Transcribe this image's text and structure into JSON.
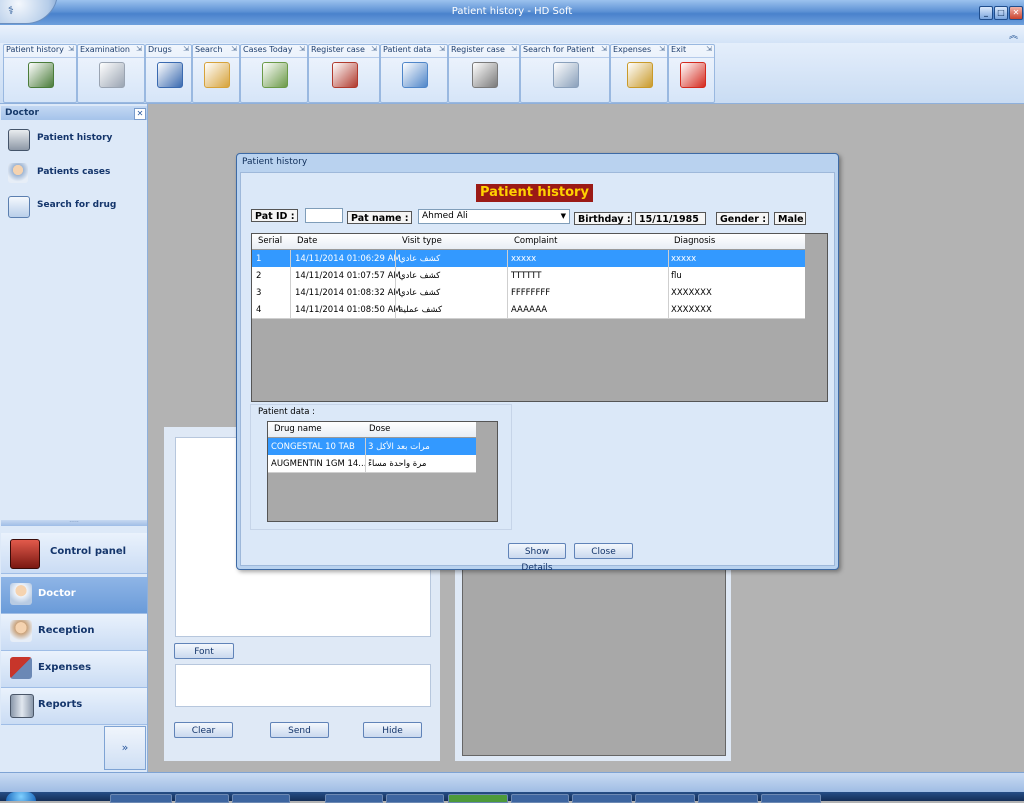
{
  "window": {
    "title": "Patient history - HD Soft"
  },
  "window_controls": [
    "_",
    "□",
    "✕"
  ],
  "ribbon": {
    "groups": [
      {
        "label": "Patient history",
        "icon": "patient-history-icon",
        "color": "#4a7c3a"
      },
      {
        "label": "Examination",
        "icon": "examination-icon",
        "color": "#9aa4b2"
      },
      {
        "label": "Drugs",
        "icon": "drugs-icon",
        "color": "#3a6ab0"
      },
      {
        "label": "Search",
        "icon": "magnifier-icon",
        "color": "#d6a23a"
      },
      {
        "label": "Cases Today",
        "icon": "cases-today-icon",
        "color": "#6b9a48"
      },
      {
        "label": "Register case",
        "icon": "register-case-icon",
        "color": "#b03a2e"
      },
      {
        "label": "Patient  data",
        "icon": "patient-data-icon",
        "color": "#4f86c9"
      },
      {
        "label": "Register case",
        "icon": "register-case-2-icon",
        "color": "#7a7a7a"
      },
      {
        "label": "Search for  Patient",
        "icon": "search-patient-icon",
        "color": "#8aa0bb"
      },
      {
        "label": "Expenses",
        "icon": "money-bag-icon",
        "color": "#c99a2a"
      },
      {
        "label": "Exit",
        "icon": "exit-icon",
        "color": "#d42a1e"
      }
    ]
  },
  "sidebar": {
    "header": "Doctor",
    "items": [
      {
        "label": "Patient history",
        "icon": "patient-history-icon"
      },
      {
        "label": "Patients cases",
        "icon": "patient-cases-icon"
      },
      {
        "label": "Search for drug",
        "icon": "search-drug-icon"
      }
    ],
    "nav": [
      {
        "label": "Control panel",
        "icon": "control-panel-icon",
        "active": false
      },
      {
        "label": "Doctor",
        "icon": "doctor-icon",
        "active": true
      },
      {
        "label": "Reception",
        "icon": "reception-icon",
        "active": false
      },
      {
        "label": "Expenses",
        "icon": "expenses-icon",
        "active": false
      },
      {
        "label": "Reports",
        "icon": "reports-icon",
        "active": false
      }
    ]
  },
  "chat": {
    "font_button": "Font",
    "clear_button": "Clear",
    "send_button": "Send",
    "hide_button": "Hide"
  },
  "dialog": {
    "title": "Patient history",
    "heading": "Patient history",
    "pat_id_label": "Pat ID :",
    "pat_id_value": "",
    "pat_name_label": "Pat name :",
    "pat_name_value": "Ahmed Ali",
    "birthday_label": "Birthday :",
    "birthday_value": "15/11/1985",
    "gender_label": "Gender :",
    "gender_value": "Male",
    "history_columns": [
      "Serial",
      "Date",
      "Visit type",
      "Complaint",
      "Diagnosis"
    ],
    "history_rows": [
      {
        "serial": "1",
        "date": "14/11/2014 01:06:29 AM",
        "visit_type": "كشف عادي",
        "complaint": "xxxxx",
        "diagnosis": "xxxxx",
        "selected": true
      },
      {
        "serial": "2",
        "date": "14/11/2014 01:07:57 AM",
        "visit_type": "كشف عادي",
        "complaint": "TTTTTT",
        "diagnosis": "flu",
        "selected": false
      },
      {
        "serial": "3",
        "date": "14/11/2014 01:08:32 AM",
        "visit_type": "كشف عادي",
        "complaint": "FFFFFFFF",
        "diagnosis": "XXXXXXX",
        "selected": false
      },
      {
        "serial": "4",
        "date": "14/11/2014 01:08:50 AM",
        "visit_type": "كشف عملية",
        "complaint": "AAAAAA",
        "diagnosis": "XXXXXXX",
        "selected": false
      }
    ],
    "patient_data_label": "Patient data :",
    "drug_columns": [
      "Drug name",
      "Dose"
    ],
    "drug_rows": [
      {
        "drug": "CONGESTAL 10 TAB",
        "dose": "3 مرات بعد الأكل",
        "selected": true
      },
      {
        "drug": "AUGMENTIN 1GM 14...",
        "dose": "مرة واحدة مساءً",
        "selected": false
      }
    ],
    "show_details_button": "Show Details",
    "close_button": "Close"
  },
  "colors": {
    "selection": "#3399ff",
    "heading_bg": "#9b1a16",
    "heading_fg": "#ffd200"
  }
}
